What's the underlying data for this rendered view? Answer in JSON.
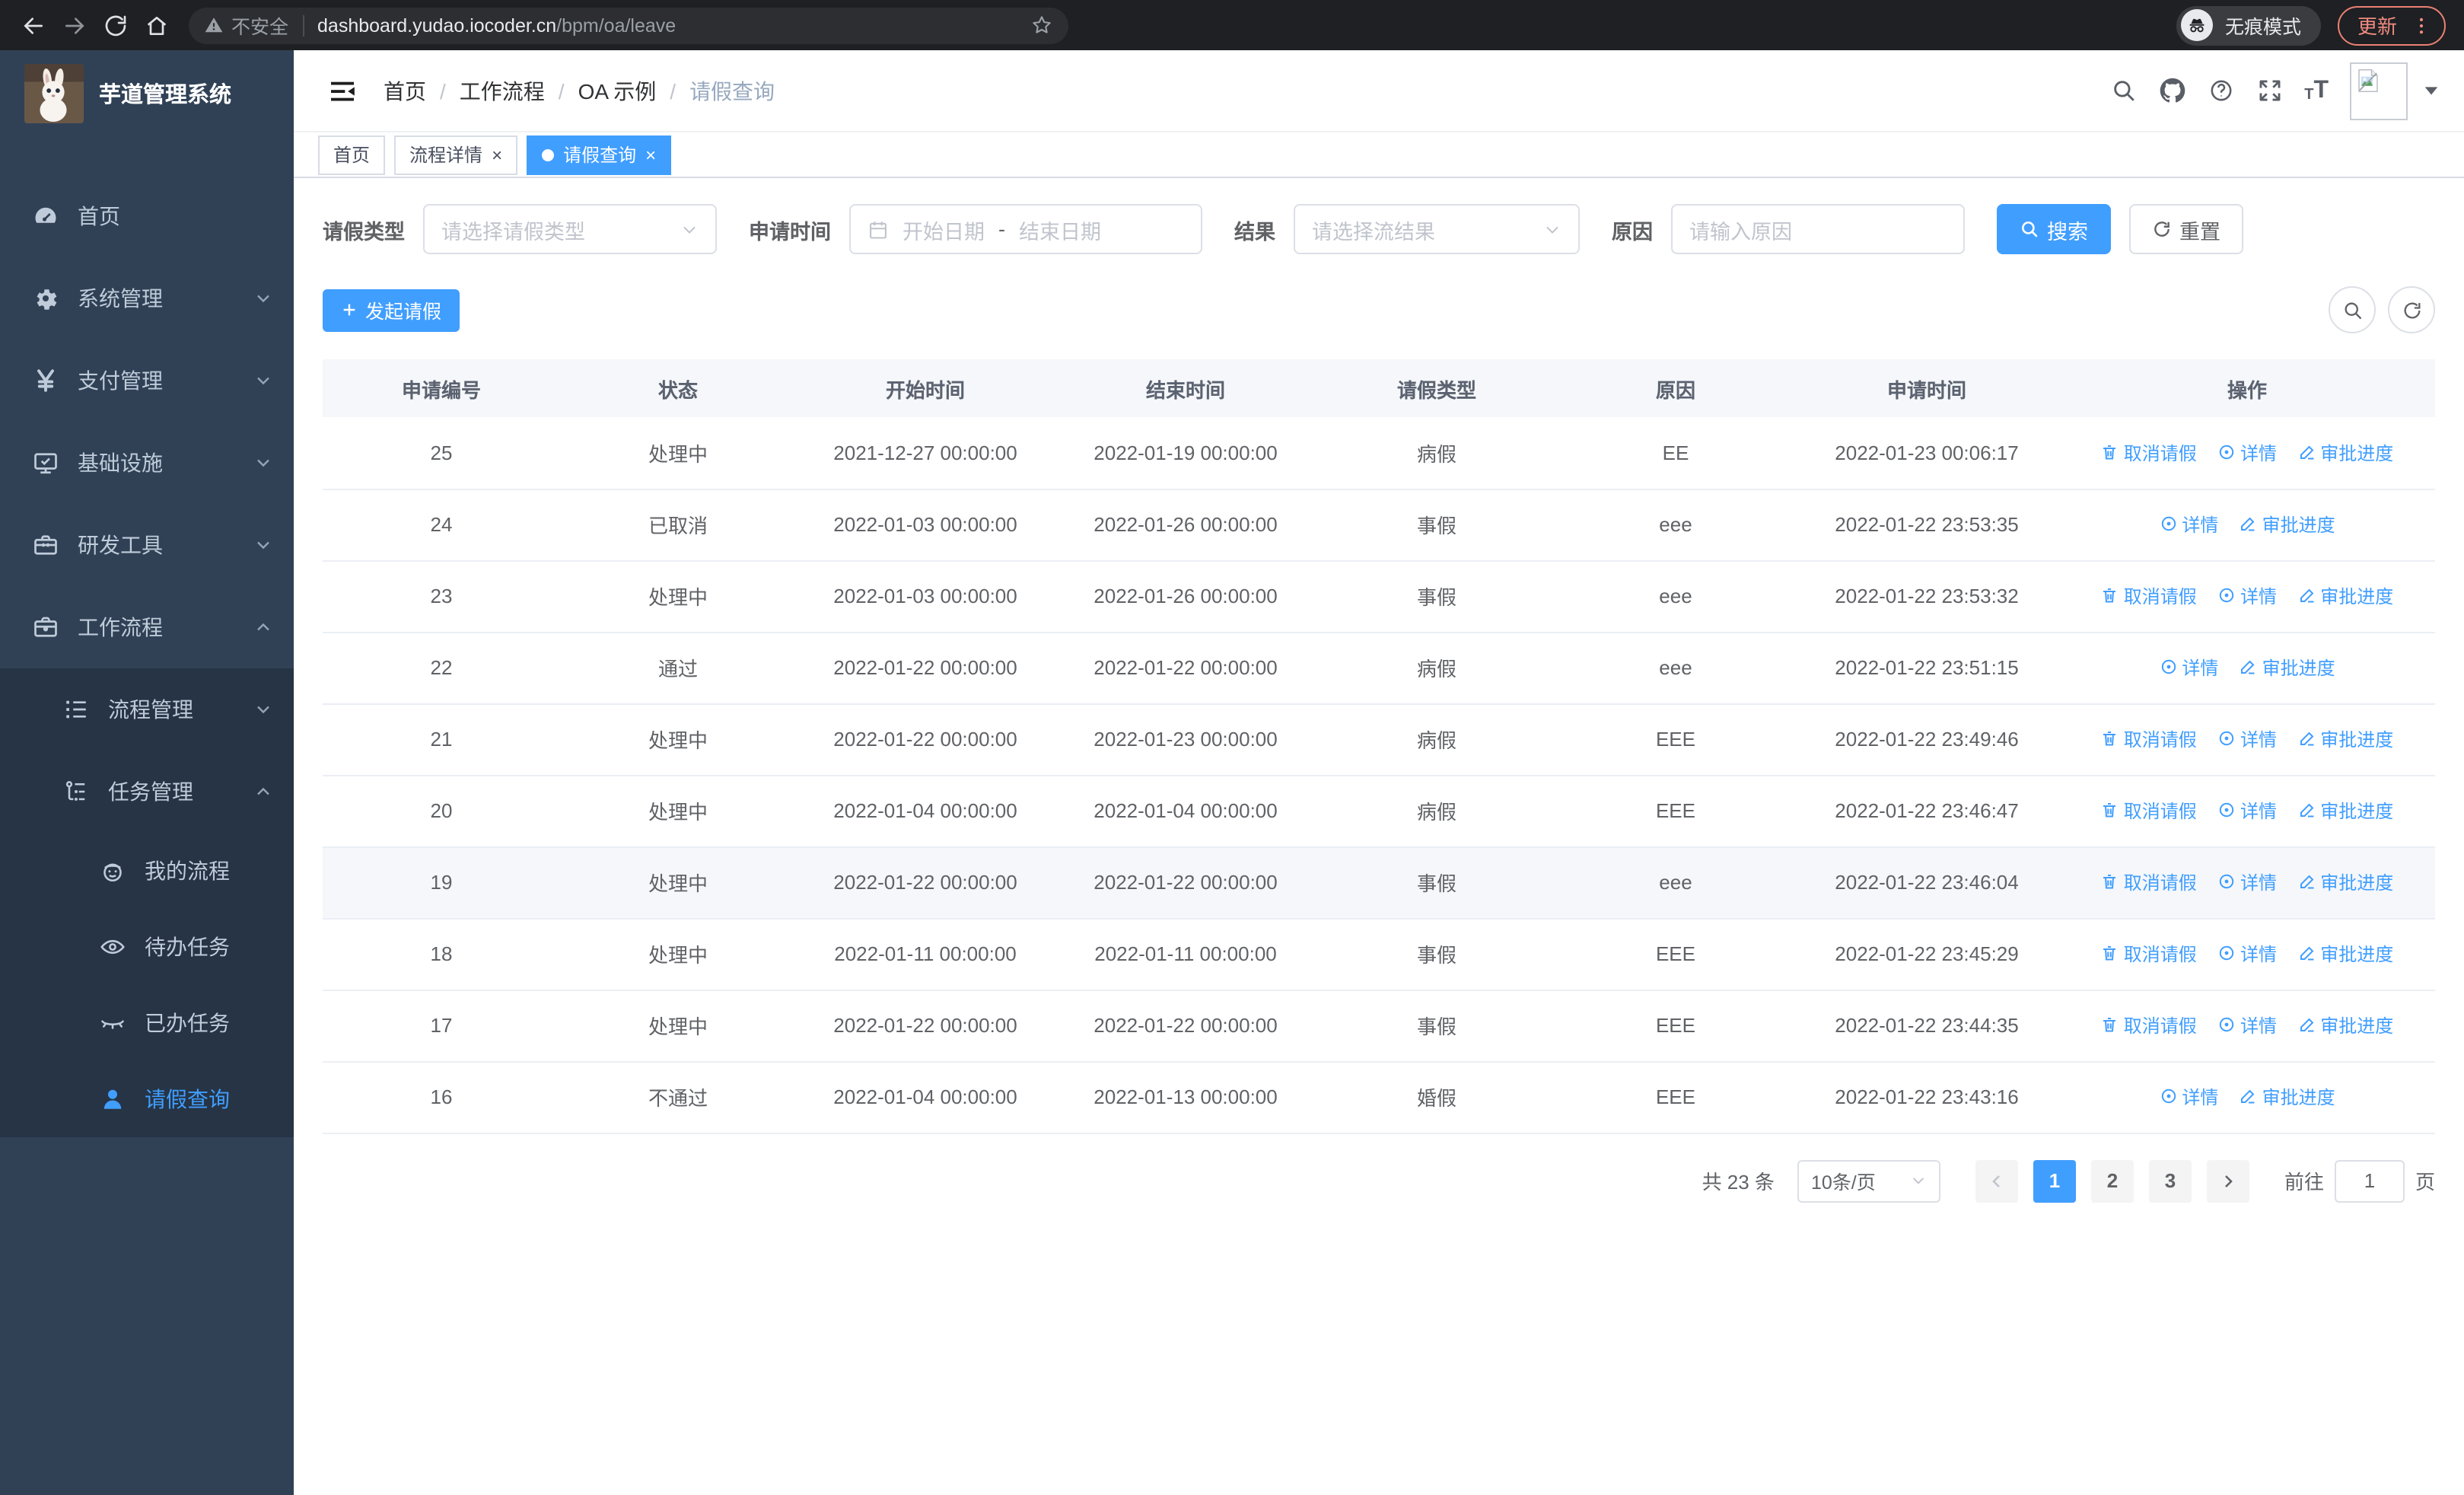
{
  "browser": {
    "security_label": "不安全",
    "url_host": "dashboard.yudao.iocoder.cn",
    "url_path": "/bpm/oa/leave",
    "incognito_label": "无痕模式",
    "update_label": "更新"
  },
  "sidebar": {
    "app_title": "芋道管理系统",
    "menu": [
      {
        "label": "首页",
        "icon": "dashboard-icon"
      },
      {
        "label": "系统管理",
        "icon": "gear-icon"
      },
      {
        "label": "支付管理",
        "icon": "yen-icon"
      },
      {
        "label": "基础设施",
        "icon": "monitor-icon"
      },
      {
        "label": "研发工具",
        "icon": "toolbox-icon"
      },
      {
        "label": "工作流程",
        "icon": "briefcase-icon"
      }
    ],
    "workflow_children": [
      {
        "label": "流程管理",
        "icon": "list-icon"
      },
      {
        "label": "任务管理",
        "icon": "tree-icon"
      }
    ],
    "task_children": [
      {
        "label": "我的流程",
        "icon": "face-icon"
      },
      {
        "label": "待办任务",
        "icon": "eye-icon"
      },
      {
        "label": "已办任务",
        "icon": "eye-closed-icon"
      },
      {
        "label": "请假查询",
        "icon": "user-icon"
      }
    ]
  },
  "header": {
    "breadcrumb": [
      "首页",
      "工作流程",
      "OA 示例",
      "请假查询"
    ]
  },
  "tabs": [
    {
      "label": "首页"
    },
    {
      "label": "流程详情"
    },
    {
      "label": "请假查询"
    }
  ],
  "filters": {
    "leave_type_label": "请假类型",
    "leave_type_placeholder": "请选择请假类型",
    "apply_time_label": "申请时间",
    "start_date_placeholder": "开始日期",
    "range_separator": "-",
    "end_date_placeholder": "结束日期",
    "result_label": "结果",
    "result_placeholder": "请选择流结果",
    "reason_label": "原因",
    "reason_placeholder": "请输入原因",
    "search_button": "搜索",
    "reset_button": "重置"
  },
  "toolbar": {
    "create_button": "发起请假"
  },
  "table": {
    "columns": [
      "申请编号",
      "状态",
      "开始时间",
      "结束时间",
      "请假类型",
      "原因",
      "申请时间",
      "操作"
    ],
    "actions": {
      "cancel": "取消请假",
      "detail": "详情",
      "progress": "审批进度"
    },
    "rows": [
      {
        "id": "25",
        "status": "处理中",
        "start": "2021-12-27 00:00:00",
        "end": "2022-01-19 00:00:00",
        "type": "病假",
        "reason": "EE",
        "applied": "2022-01-23 00:06:17",
        "can_cancel": true,
        "highlight": false
      },
      {
        "id": "24",
        "status": "已取消",
        "start": "2022-01-03 00:00:00",
        "end": "2022-01-26 00:00:00",
        "type": "事假",
        "reason": "eee",
        "applied": "2022-01-22 23:53:35",
        "can_cancel": false,
        "highlight": false
      },
      {
        "id": "23",
        "status": "处理中",
        "start": "2022-01-03 00:00:00",
        "end": "2022-01-26 00:00:00",
        "type": "事假",
        "reason": "eee",
        "applied": "2022-01-22 23:53:32",
        "can_cancel": true,
        "highlight": false
      },
      {
        "id": "22",
        "status": "通过",
        "start": "2022-01-22 00:00:00",
        "end": "2022-01-22 00:00:00",
        "type": "病假",
        "reason": "eee",
        "applied": "2022-01-22 23:51:15",
        "can_cancel": false,
        "highlight": false
      },
      {
        "id": "21",
        "status": "处理中",
        "start": "2022-01-22 00:00:00",
        "end": "2022-01-23 00:00:00",
        "type": "病假",
        "reason": "EEE",
        "applied": "2022-01-22 23:49:46",
        "can_cancel": true,
        "highlight": false
      },
      {
        "id": "20",
        "status": "处理中",
        "start": "2022-01-04 00:00:00",
        "end": "2022-01-04 00:00:00",
        "type": "病假",
        "reason": "EEE",
        "applied": "2022-01-22 23:46:47",
        "can_cancel": true,
        "highlight": false
      },
      {
        "id": "19",
        "status": "处理中",
        "start": "2022-01-22 00:00:00",
        "end": "2022-01-22 00:00:00",
        "type": "事假",
        "reason": "eee",
        "applied": "2022-01-22 23:46:04",
        "can_cancel": true,
        "highlight": true
      },
      {
        "id": "18",
        "status": "处理中",
        "start": "2022-01-11 00:00:00",
        "end": "2022-01-11 00:00:00",
        "type": "事假",
        "reason": "EEE",
        "applied": "2022-01-22 23:45:29",
        "can_cancel": true,
        "highlight": false
      },
      {
        "id": "17",
        "status": "处理中",
        "start": "2022-01-22 00:00:00",
        "end": "2022-01-22 00:00:00",
        "type": "事假",
        "reason": "EEE",
        "applied": "2022-01-22 23:44:35",
        "can_cancel": true,
        "highlight": false
      },
      {
        "id": "16",
        "status": "不通过",
        "start": "2022-01-04 00:00:00",
        "end": "2022-01-13 00:00:00",
        "type": "婚假",
        "reason": "EEE",
        "applied": "2022-01-22 23:43:16",
        "can_cancel": false,
        "highlight": false
      }
    ]
  },
  "pagination": {
    "total": "共 23 条",
    "page_size": "10条/页",
    "pages": [
      "1",
      "2",
      "3"
    ],
    "active_page": "1",
    "goto_label": "前往",
    "goto_value": "1",
    "goto_unit": "页"
  },
  "colors": {
    "primary": "#409eff",
    "sidebar_bg": "#304156",
    "submenu_bg": "#263445",
    "link_blue": "#409eff"
  }
}
